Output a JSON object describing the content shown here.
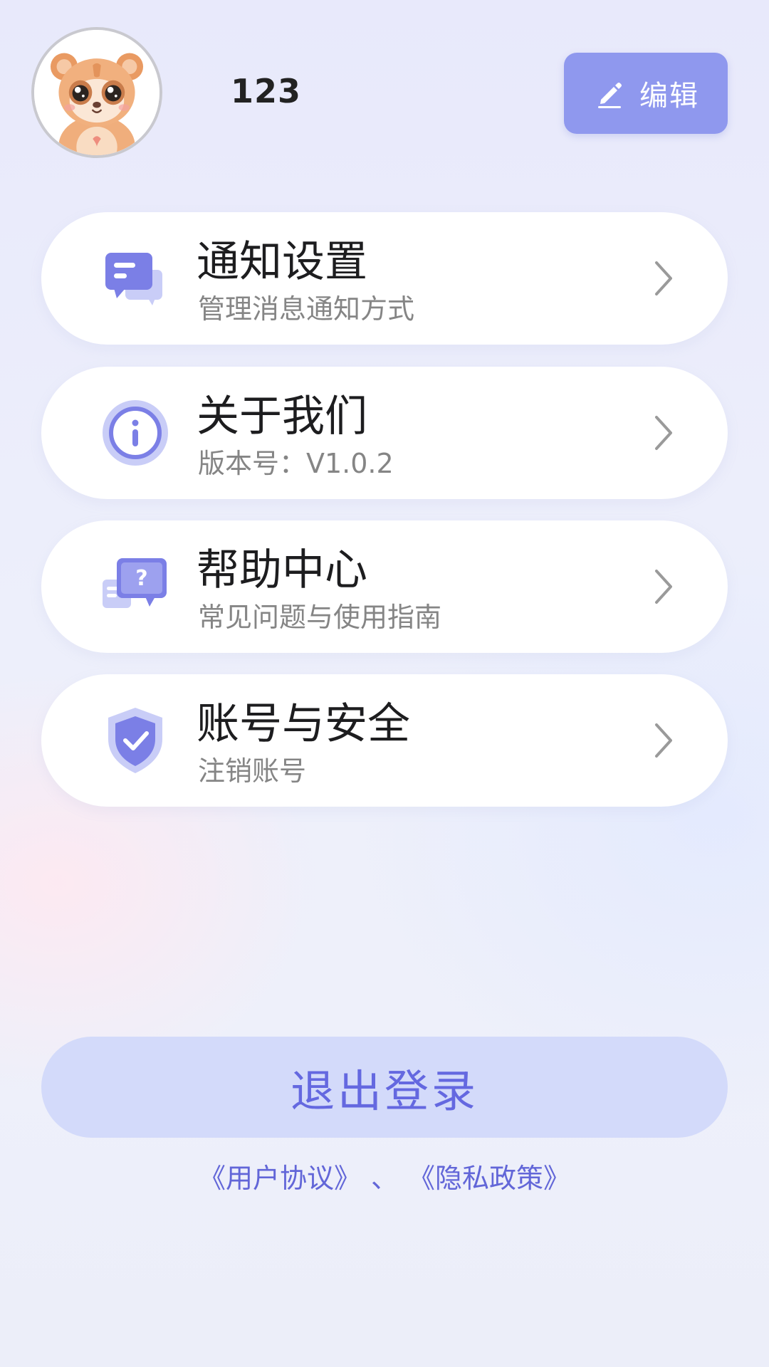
{
  "header": {
    "username": "123",
    "edit_label": "编辑"
  },
  "menu": {
    "items": [
      {
        "title": "通知设置",
        "subtitle": "管理消息通知方式",
        "icon": "message-bubble-icon"
      },
      {
        "title": "关于我们",
        "subtitle": "版本号：V1.0.2",
        "icon": "info-icon"
      },
      {
        "title": "帮助中心",
        "subtitle": "常见问题与使用指南",
        "icon": "help-chat-icon"
      },
      {
        "title": "账号与安全",
        "subtitle": "注销账号",
        "icon": "shield-check-icon"
      }
    ]
  },
  "logout": {
    "label": "退出登录"
  },
  "legal": {
    "user_agreement": "《用户协议》",
    "separator": "、",
    "privacy_policy": "《隐私政策》"
  },
  "colors": {
    "accent": "#6468e0",
    "edit_button_bg": "#8f98ee",
    "logout_bg": "#d3dafa",
    "icon_primary": "#7b7fe6",
    "icon_light": "#c9cdf7"
  }
}
